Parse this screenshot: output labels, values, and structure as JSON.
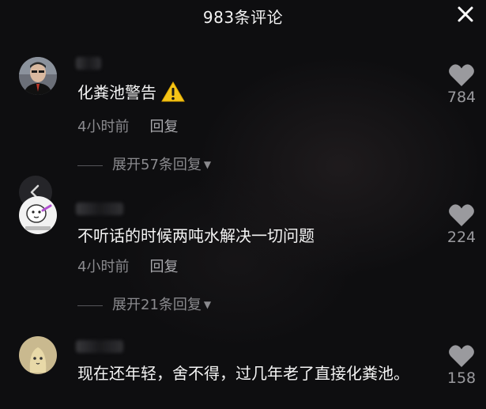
{
  "header": {
    "title": "983条评论"
  },
  "comments": [
    {
      "text": "化粪池警告",
      "time": "4小时前",
      "reply_label": "回复",
      "expand_label": "展开57条回复",
      "likes": "784"
    },
    {
      "text": "不听话的时候两吨水解决一切问题",
      "time": "4小时前",
      "reply_label": "回复",
      "expand_label": "展开21条回复",
      "likes": "224"
    },
    {
      "text": "现在还年轻，舍不得，过几年老了直接化粪池。",
      "likes": "158"
    }
  ],
  "icons": {
    "close": "close-icon",
    "like": "heart-icon",
    "warning": "warning-icon",
    "back": "chevron-left-icon"
  },
  "colors": {
    "background": "#0e0e10",
    "text": "#f4f4f4",
    "secondary_text": "#8a8a8e",
    "heart": "#9a9a9e",
    "warning": "#f5c518"
  }
}
